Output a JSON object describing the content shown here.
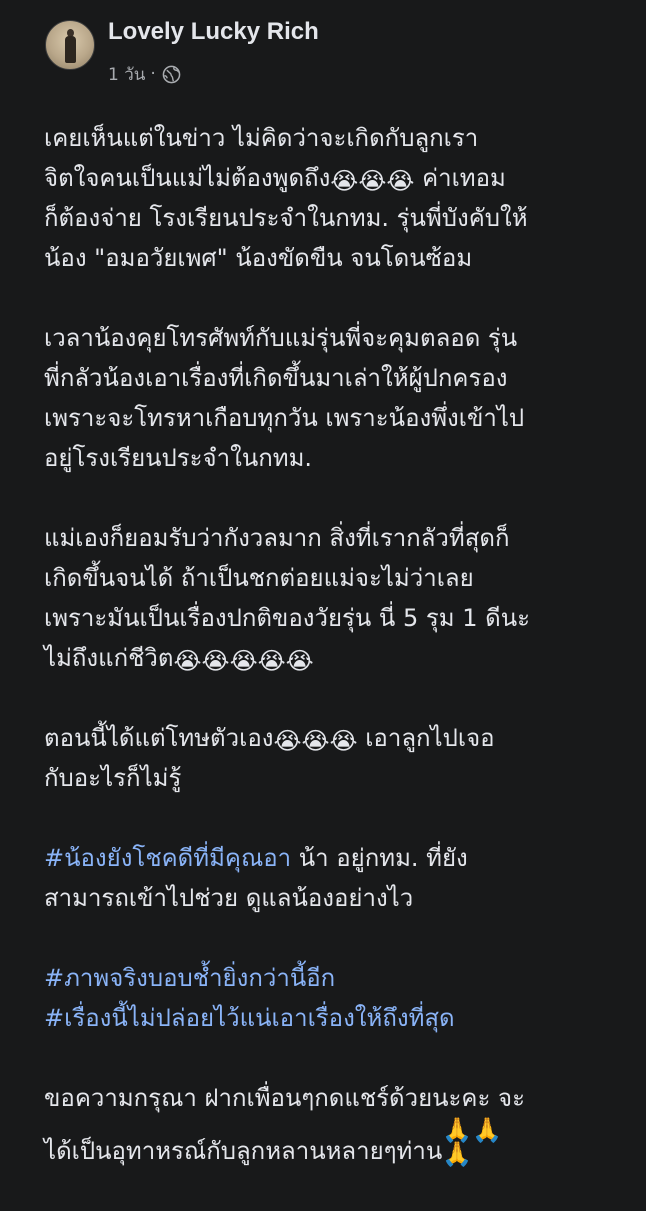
{
  "post": {
    "author": "Lovely Lucky Rich",
    "time": "1 วัน",
    "separator": "·",
    "privacy_icon": "globe-icon",
    "avatar_icon": "avatar",
    "paragraphs": {
      "p1": "เคยเห็นแต่ในข่าว ไม่คิดว่าจะเกิดกับลูกเรา\nจิตใจคนเป็นแม่ไม่ต้องพูดถึง",
      "p1_emoji": "😭😭😭",
      "p1_cont": "  ค่าเทอม\nก็ต้องจ่าย โรงเรียนประจำในกทม. รุ่นพี่บังคับให้\nน้อง  \"อมอวัยเพศ\"   น้องขัดขืน จนโดนซ้อม",
      "p2": " เวลาน้องคุยโทรศัพท์กับแม่รุ่นพี่จะคุมตลอด รุ่น\nพี่กลัวน้องเอาเรื่องที่เกิดขึ้นมาเล่าให้ผู้ปกครอง\nเพราะจะโทรหาเกือบทุกวัน เพราะน้องพึ่งเข้าไป\nอยู่โรงเรียนประจำในกทม.",
      "p3": "แม่เองก็ยอมรับว่ากังวลมาก   สิ่งที่เรากลัวที่สุดก็\nเกิดขึ้นจนได้ ถ้าเป็นชกต่อยแม่จะไม่ว่าเลย\nเพราะมันเป็นเรื่องปกติของวัยรุ่น นี่ 5 รุม 1 ดีนะ\nไม่ถึงแก่ชีวิต",
      "p3_emoji": "😭😭😭😭😭",
      "p4": "ตอนนี้ได้แต่โทษตัวเอง",
      "p4_emoji": "😭😭😭",
      "p4_cont": " เอาลูกไปเจอ\nกับอะไรก็ไม่รู้",
      "p5_hashtag": "#น้องยังโชคดีที่มีคุณอา",
      "p5_text": " น้า อยู่กทม. ที่ยัง\nสามารถเข้าไปช่วย ดูแลน้องอย่างไว",
      "p6_hashtag1": "#ภาพจริงบอบช้ำยิ่งกว่านี้อีก",
      "p6_hashtag2": "#เรื่องนี้ไม่ปล่อยไว้แน่เอาเรื่องให้ถึงที่สุด",
      "p7": "ขอความกรุณา ฝากเพื่อนๆกดแชร์ด้วยนะคะ จะ\nได้เป็นอุทาหรณ์กับลูกหลานหลายๆท่าน",
      "p7_emoji": "🙏🙏\n🙏"
    }
  },
  "colors": {
    "background": "#18191a",
    "text": "#e4e6eb",
    "meta": "#a8abaf",
    "hashtag": "#8ab4f8"
  }
}
